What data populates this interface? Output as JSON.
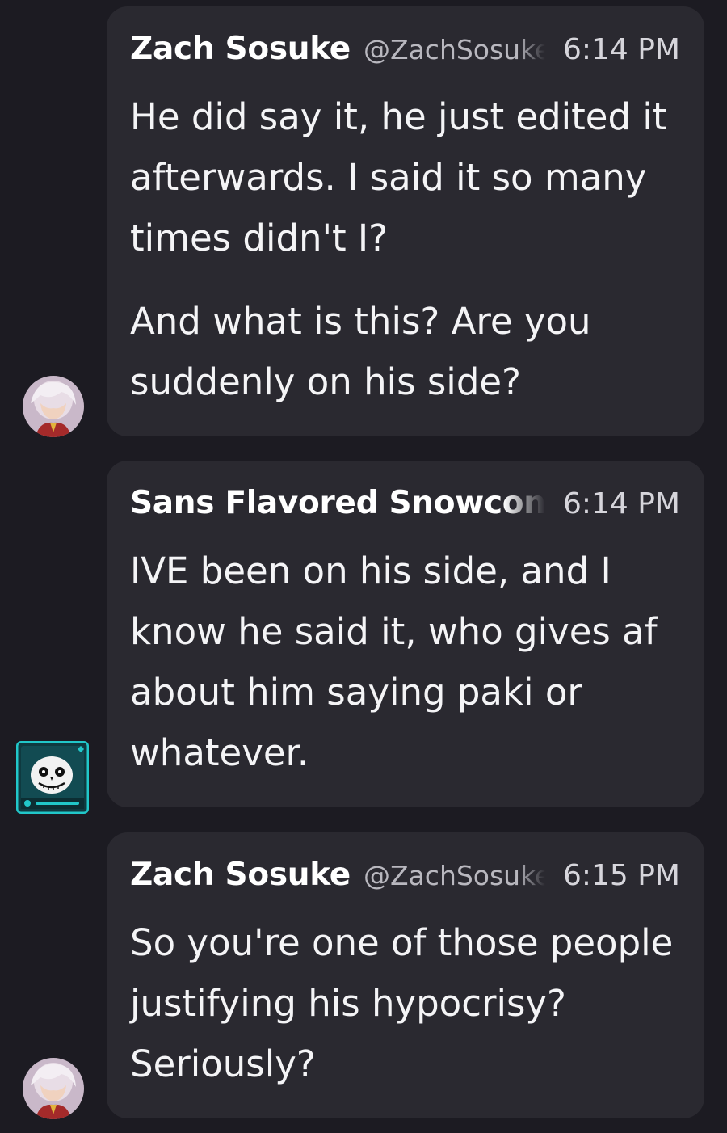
{
  "messages": [
    {
      "author": "Zach Sosuke",
      "handle": "@ZachSosuke",
      "time": "6:14 PM",
      "paragraphs": [
        "He did say it, he just edited it afterwards. I said it so many times didn't I?",
        "And what is this? Are you suddenly on his side?"
      ],
      "avatar_icon": "anime-character-avatar-icon"
    },
    {
      "author": "Sans Flavored Snowcone",
      "time": "6:14 PM",
      "paragraphs": [
        "IVE been on his side, and I know he said it, who gives af about him saying paki or whatever."
      ],
      "avatar_icon": "sans-skull-avatar-icon"
    },
    {
      "author": "Zach Sosuke",
      "handle": "@ZachSosuke",
      "time": "6:15 PM",
      "paragraphs": [
        "So you're one of those people justifying his hypocrisy? Seriously?"
      ],
      "avatar_icon": "anime-character-avatar-icon"
    }
  ],
  "colors": {
    "background": "#1c1b22",
    "bubble": "#2a2930",
    "text": "#f4f4f6",
    "handle": "#b9b8bf",
    "avatar_accent": "#21c7c9"
  }
}
